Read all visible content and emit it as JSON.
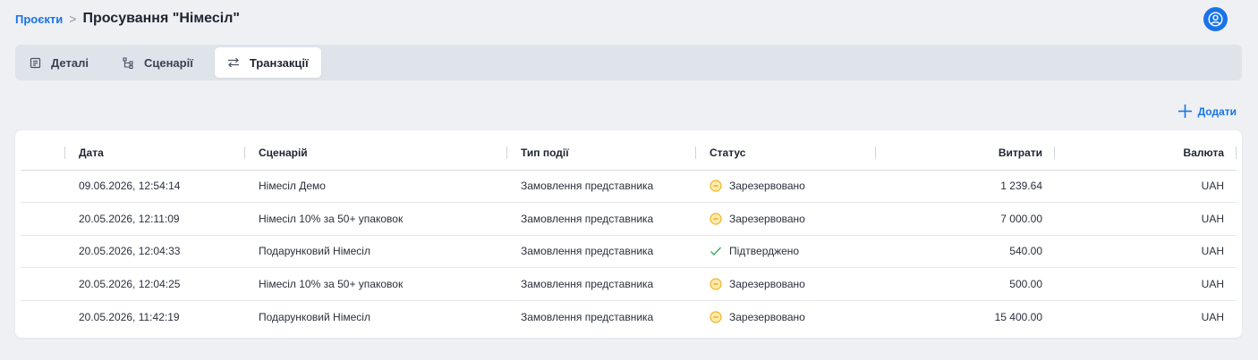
{
  "breadcrumb": {
    "root": "Проєкти",
    "separator": ">",
    "current": "Просування \"Німесіл\""
  },
  "tabs": [
    {
      "label": "Деталі",
      "icon": "document-icon",
      "active": false
    },
    {
      "label": "Сценарії",
      "icon": "tree-icon",
      "active": false
    },
    {
      "label": "Транзакції",
      "icon": "transfer-icon",
      "active": true
    }
  ],
  "add_button": {
    "label": "Додати",
    "icon": "plus-icon"
  },
  "table": {
    "columns": [
      "Дата",
      "Сценарій",
      "Тип події",
      "Статус",
      "Витрати",
      "Валюта"
    ],
    "rows": [
      {
        "date": "09.06.2026, 12:54:14",
        "scenario": "Німесіл Демо",
        "event": "Замовлення представника",
        "status": "Зарезервовано",
        "status_kind": "reserved",
        "cost": "1 239.64",
        "currency": "UAH"
      },
      {
        "date": "20.05.2026, 12:11:09",
        "scenario": "Німесіл 10% за 50+ упаковок",
        "event": "Замовлення представника",
        "status": "Зарезервовано",
        "status_kind": "reserved",
        "cost": "7 000.00",
        "currency": "UAH"
      },
      {
        "date": "20.05.2026, 12:04:33",
        "scenario": "Подарунковий Німесіл",
        "event": "Замовлення представника",
        "status": "Підтверджено",
        "status_kind": "confirmed",
        "cost": "540.00",
        "currency": "UAH"
      },
      {
        "date": "20.05.2026, 12:04:25",
        "scenario": "Німесіл 10% за 50+ упаковок",
        "event": "Замовлення представника",
        "status": "Зарезервовано",
        "status_kind": "reserved",
        "cost": "500.00",
        "currency": "UAH"
      },
      {
        "date": "20.05.2026, 11:42:19",
        "scenario": "Подарунковий Німесіл",
        "event": "Замовлення представника",
        "status": "Зарезервовано",
        "status_kind": "reserved",
        "cost": "15 400.00",
        "currency": "UAH"
      }
    ]
  },
  "colors": {
    "accent": "#1a73e8",
    "reserved": "#f0b429",
    "confirmed": "#3aaa5c"
  }
}
